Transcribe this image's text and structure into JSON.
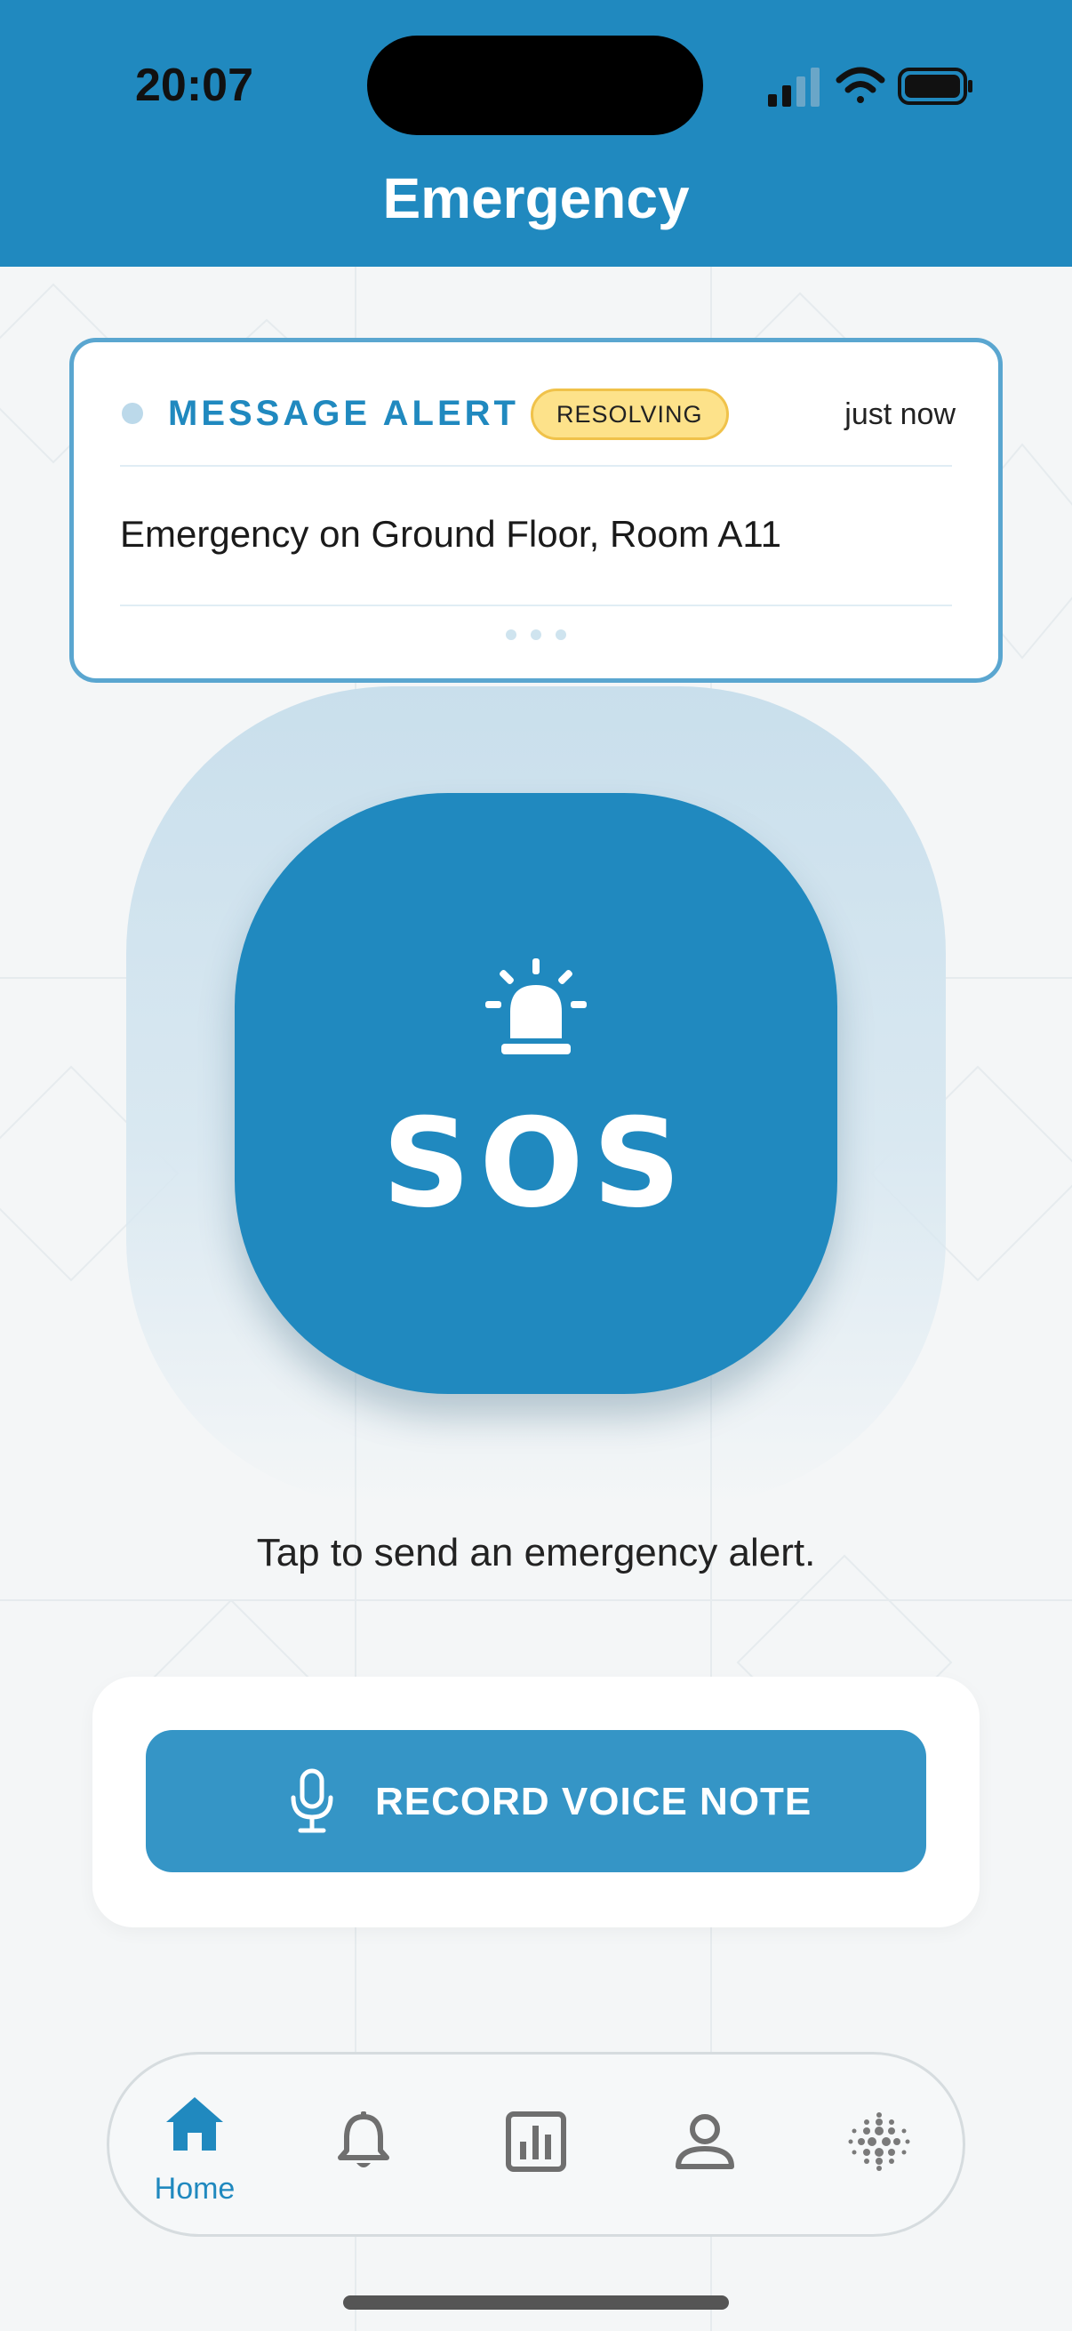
{
  "status_bar": {
    "time": "20:07"
  },
  "header": {
    "title": "Emergency"
  },
  "alert": {
    "title": "MESSAGE ALERT",
    "badge": "RESOLVING",
    "time": "just now",
    "message": "Emergency on Ground Floor, Room A11"
  },
  "sos": {
    "label": "SOS",
    "icon": "siren-icon",
    "hint": "Tap to send an emergency alert."
  },
  "voice": {
    "label": "RECORD VOICE NOTE",
    "icon": "microphone-icon"
  },
  "nav": {
    "items": [
      {
        "icon": "home-icon",
        "label": "Home",
        "active": true
      },
      {
        "icon": "bell-icon",
        "label": "",
        "active": false
      },
      {
        "icon": "chart-icon",
        "label": "",
        "active": false
      },
      {
        "icon": "user-icon",
        "label": "",
        "active": false
      },
      {
        "icon": "dots-grid-icon",
        "label": "",
        "active": false
      }
    ]
  },
  "colors": {
    "primary": "#2089bf",
    "voice_button": "#3595c6",
    "badge_bg": "#fde28a",
    "badge_border": "#f0c24a",
    "background": "#f4f6f7",
    "inactive_icon": "#6f6f6f"
  }
}
